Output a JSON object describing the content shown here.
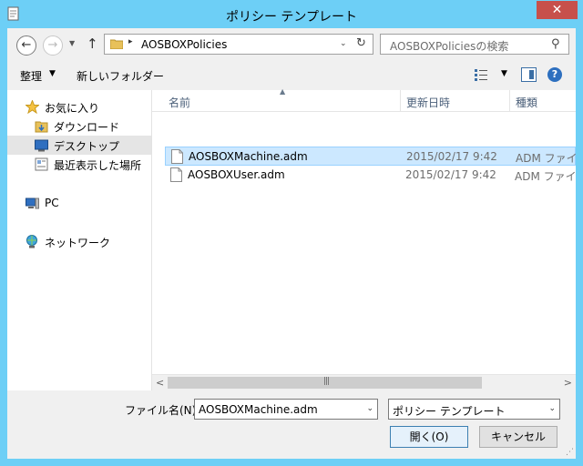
{
  "window": {
    "title": "ポリシー テンプレート",
    "close_glyph": "✕"
  },
  "address": {
    "path": "AOSBOXPolicies",
    "separator": "▸"
  },
  "search": {
    "placeholder": "AOSBOXPoliciesの検索"
  },
  "toolbar": {
    "organize_label": "整理",
    "new_folder_label": "新しいフォルダー"
  },
  "navpane": {
    "items": [
      {
        "label": "お気に入り",
        "icon": "star-icon"
      },
      {
        "label": "ダウンロード",
        "icon": "downloads-folder-icon"
      },
      {
        "label": "デスクトップ",
        "icon": "desktop-icon"
      },
      {
        "label": "最近表示した場所",
        "icon": "recent-places-icon"
      },
      {
        "label": "PC",
        "icon": "pc-icon"
      },
      {
        "label": "ネットワーク",
        "icon": "network-icon"
      }
    ]
  },
  "files": {
    "columns": [
      "名前",
      "更新日時",
      "種類"
    ],
    "rows": [
      {
        "name": "AOSBOXMachine.adm",
        "date": "2015/02/17 9:42",
        "type": "ADM ファイル",
        "selected": true
      },
      {
        "name": "AOSBOXUser.adm",
        "date": "2015/02/17 9:42",
        "type": "ADM ファイル",
        "selected": false
      }
    ]
  },
  "bottom": {
    "filename_label": "ファイル名(N):",
    "filename_value": "AOSBOXMachine.adm",
    "filetype_value": "ポリシー テンプレート",
    "open_label": "開く(O)",
    "cancel_label": "キャンセル"
  },
  "colors": {
    "title_bar": "#6dcff6",
    "selection": "#cce8ff",
    "close_button": "#c7504b"
  }
}
